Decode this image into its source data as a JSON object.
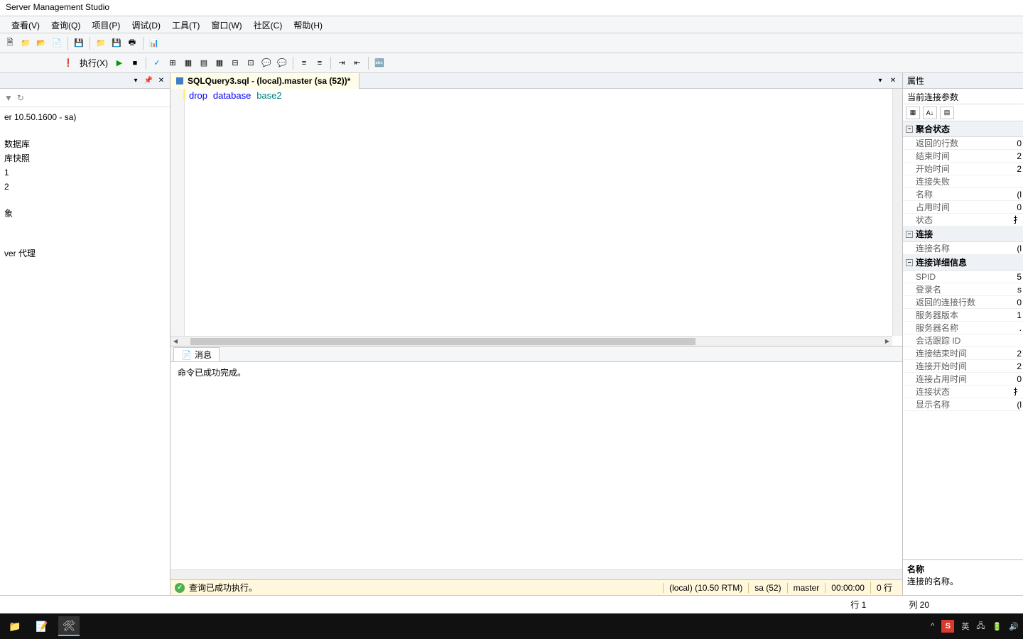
{
  "title": "Server Management Studio",
  "menu": {
    "view": "查看(V)",
    "query": "查询(Q)",
    "project": "项目(P)",
    "debug": "调试(D)",
    "tools": "工具(T)",
    "window": "窗口(W)",
    "community": "社区(C)",
    "help": "帮助(H)"
  },
  "toolbar2": {
    "execute": "执行(X)"
  },
  "leftPane": {
    "connection": "er 10.50.1600 - sa)",
    "items": [
      "数据库",
      "库快照",
      "1",
      "2",
      "象",
      "ver 代理"
    ]
  },
  "docTab": {
    "title": "SQLQuery3.sql - (local).master (sa (52))*"
  },
  "editor": {
    "kw1": "drop",
    "kw2": "database",
    "ident": "base2"
  },
  "messages": {
    "tab": "消息",
    "text": "命令已成功完成。"
  },
  "queryStatus": {
    "msg": "查询已成功执行。",
    "server": "(local) (10.50 RTM)",
    "user": "sa (52)",
    "db": "master",
    "time": "00:00:00",
    "rows": "0 行"
  },
  "properties": {
    "title": "属性",
    "subtitle": "当前连接参数",
    "cat1": "聚合状态",
    "rows1": [
      {
        "k": "返回的行数",
        "v": "0"
      },
      {
        "k": "结束时间",
        "v": "2"
      },
      {
        "k": "开始时间",
        "v": "2"
      },
      {
        "k": "连接失败",
        "v": ""
      },
      {
        "k": "名称",
        "v": "(l"
      },
      {
        "k": "占用时间",
        "v": "0"
      },
      {
        "k": "状态",
        "v": "扌"
      }
    ],
    "cat2": "连接",
    "rows2": [
      {
        "k": "连接名称",
        "v": "(l"
      }
    ],
    "cat3": "连接详细信息",
    "rows3": [
      {
        "k": "SPID",
        "v": "5"
      },
      {
        "k": "登录名",
        "v": "s"
      },
      {
        "k": "返回的连接行数",
        "v": "0"
      },
      {
        "k": "服务器版本",
        "v": "1"
      },
      {
        "k": "服务器名称",
        "v": "."
      },
      {
        "k": "会话跟踪 ID",
        "v": ""
      },
      {
        "k": "连接结束时间",
        "v": "2"
      },
      {
        "k": "连接开始时间",
        "v": "2"
      },
      {
        "k": "连接占用时间",
        "v": "0"
      },
      {
        "k": "连接状态",
        "v": "扌"
      },
      {
        "k": "显示名称",
        "v": "(l"
      }
    ],
    "descTitle": "名称",
    "descText": "连接的名称。"
  },
  "bottom": {
    "line": "行 1",
    "col": "列 20"
  },
  "tray": {
    "ime": "S",
    "lang": "英"
  }
}
